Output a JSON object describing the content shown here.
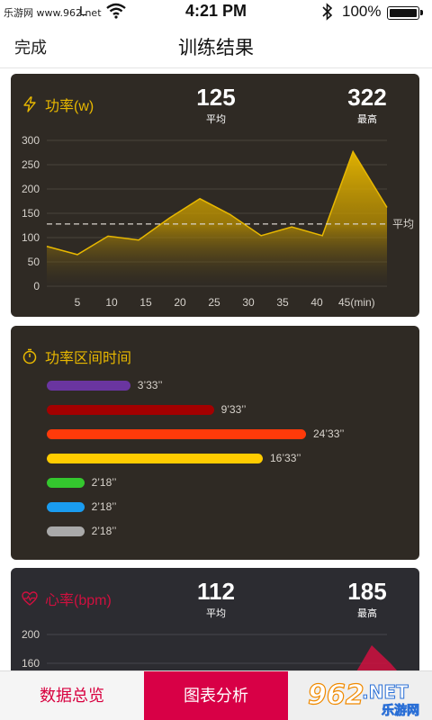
{
  "status": {
    "watermark": "乐游网 www.962.net",
    "carrier": "L",
    "time": "4:21 PM",
    "battery": "100%"
  },
  "nav": {
    "done": "完成",
    "title": "训练结果"
  },
  "power": {
    "title": "功率(w)",
    "avg_value": "125",
    "avg_label": "平均",
    "max_value": "322",
    "max_label": "最高",
    "avg_line_label": "平均",
    "accent": "#e8b800"
  },
  "zones": {
    "title": "功率区间时间",
    "items": [
      {
        "color": "#6a35a0",
        "fraction": 0.29,
        "label": "3’33’’"
      },
      {
        "color": "#a30000",
        "fraction": 0.58,
        "label": "9’33’’"
      },
      {
        "color": "#ff3a0a",
        "fraction": 0.9,
        "label": "24’33’’"
      },
      {
        "color": "#ffcc00",
        "fraction": 0.75,
        "label": "16’33’’"
      },
      {
        "color": "#34c72e",
        "fraction": 0.13,
        "label": "2’18’’"
      },
      {
        "color": "#1a9cf0",
        "fraction": 0.13,
        "label": "2’18’’"
      },
      {
        "color": "#a9a9a9",
        "fraction": 0.13,
        "label": "2’18’’"
      }
    ]
  },
  "heart": {
    "title": "心率(bpm)",
    "avg_value": "112",
    "avg_label": "平均",
    "max_value": "185",
    "max_label": "最高",
    "accent": "#d0103f"
  },
  "tabs": {
    "overview": "数据总览",
    "chart": "图表分析",
    "third": ""
  },
  "site_watermark": {
    "brand": "962",
    "suffix": ".NET",
    "sub": "乐游网"
  },
  "chart_data": [
    {
      "type": "area",
      "x_ticks": [
        "5",
        "10",
        "15",
        "20",
        "25",
        "30",
        "35",
        "40",
        "45(min)"
      ],
      "y_ticks": [
        "0",
        "50",
        "100",
        "150",
        "200",
        "250",
        "300"
      ],
      "ylim": [
        0,
        300
      ],
      "xlim": [
        0,
        50
      ],
      "x": [
        0,
        4.5,
        9,
        13.5,
        18,
        22.5,
        27,
        31.5,
        36,
        40.5,
        45,
        50
      ],
      "y": [
        82,
        65,
        103,
        95,
        140,
        180,
        147,
        104,
        122,
        104,
        277,
        162
      ],
      "reference_line": {
        "y": 128,
        "label": "平均"
      },
      "grid": true
    },
    {
      "type": "area",
      "y_ticks": [
        "200",
        "160"
      ],
      "x": [
        40,
        43,
        46,
        50
      ],
      "y": [
        140,
        185,
        160,
        120
      ]
    }
  ]
}
